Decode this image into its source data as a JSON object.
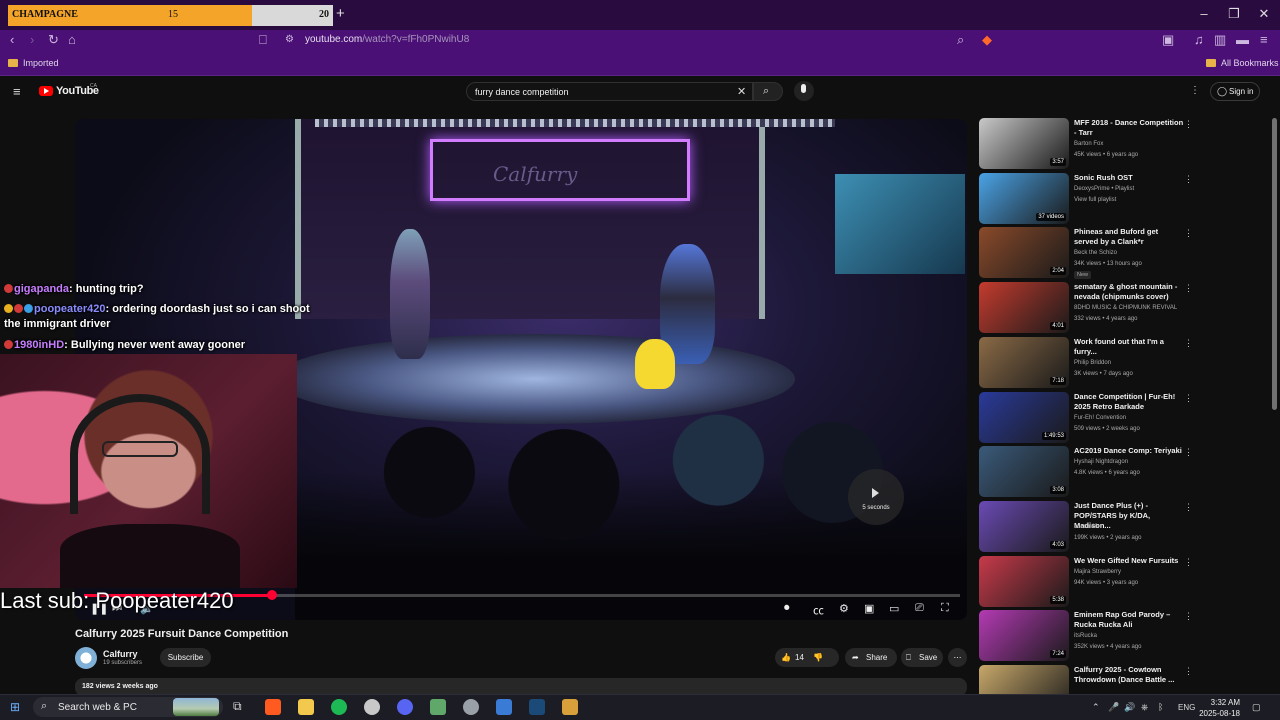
{
  "tab_widget": {
    "name": "CHAMPAGNE",
    "current": "15",
    "max": "20",
    "progress": 0.75
  },
  "browser": {
    "url_host": "youtube.com",
    "url_path": "/watch?v=fFh0PNwihU8",
    "bookmarks": {
      "folder": "Imported",
      "all": "All Bookmarks"
    }
  },
  "youtube": {
    "logo_text": "YouTube",
    "country": "CA",
    "search_value": "furry dance competition",
    "signin": "Sign in"
  },
  "player": {
    "autoplay_label": "5 seconds",
    "progress": 0.215
  },
  "overlay": {
    "chat": [
      {
        "user": "gigapanda",
        "sep": ":",
        "msg": " hunting trip?"
      },
      {
        "user": "poopeater420",
        "sep": ":",
        "msg": " ordering doordash just so i can shoot",
        "msg2": "the immigrant driver"
      },
      {
        "user": "1980inHD",
        "sep": ":",
        "msg": " Bullying never went away gooner"
      }
    ],
    "last_sub": "Last sub: Poopeater420"
  },
  "video": {
    "title": "Calfurry 2025 Fursuit Dance Competition",
    "channel": "Calfurry",
    "subscribers": "19 subscribers",
    "subscribe": "Subscribe",
    "likes": "14",
    "share": "Share",
    "save": "Save",
    "views_date": "182 views  2 weeks ago"
  },
  "recommendations": [
    {
      "title": "MFF 2018 - Dance Competition - Tarr",
      "channel": "Barton Fox",
      "meta": "45K views • 6 years ago",
      "duration": "3:57",
      "color": "#c9c9c9"
    },
    {
      "title": "Sonic Rush OST",
      "channel": "DeoxysPrime • Playlist",
      "meta": "View full playlist",
      "duration": "37 videos",
      "color": "#4aa3e6"
    },
    {
      "title": "Phineas and Buford get served by a Clank*r",
      "channel": "Beck the Schizo",
      "meta": "34K views • 13 hours ago",
      "badge": "New",
      "duration": "2:04",
      "color": "#8a4a2a"
    },
    {
      "title": "sematary & ghost mountain - nevada (chipmunks cover)",
      "channel": "8DHD MUSIC & CHIPMUNK REVIVAL",
      "meta": "332 views • 4 years ago",
      "duration": "4:01",
      "color": "#c43b2e"
    },
    {
      "title": "Work found out that I'm a furry...",
      "channel": "Philip Briddon",
      "meta": "3K views • 7 days ago",
      "duration": "7:18",
      "color": "#8a6a46"
    },
    {
      "title": "Dance Competition | Fur-Eh! 2025 Retro Barkade",
      "channel": "Fur-Eh! Convention",
      "meta": "509 views • 2 weeks ago",
      "duration": "1:49:53",
      "color": "#2a3a9a"
    },
    {
      "title": "AC2019 Dance Comp: Teriyaki",
      "channel": "Hyshaji Nightdragon",
      "meta": "4.8K views • 6 years ago",
      "duration": "3:08",
      "color": "#3a5a7a"
    },
    {
      "title": "Just Dance Plus (+) - POP/STARS by K/DA, Madison...",
      "channel": "cucchi40",
      "meta": "199K views • 2 years ago",
      "duration": "4:03",
      "color": "#6a4ab4"
    },
    {
      "title": "We Were Gifted New Fursuits",
      "channel": "Majira Strawberry",
      "meta": "94K views • 3 years ago",
      "duration": "5:38",
      "color": "#c83a4a"
    },
    {
      "title": "Eminem Rap God Parody – Rucka Rucka Ali",
      "channel": "itsRucka",
      "meta": "352K views • 4 years ago",
      "duration": "7:24",
      "color": "#b43ab4"
    },
    {
      "title": "Calfurry 2025 - Cowtown Throwdown (Dance Battle ...",
      "channel": "",
      "meta": "",
      "duration": "",
      "color": "#c8a86a"
    }
  ],
  "taskbar": {
    "search": "Search web & PC",
    "lang": "ENG",
    "time": "3:32 AM",
    "date": "2025-08-18"
  }
}
